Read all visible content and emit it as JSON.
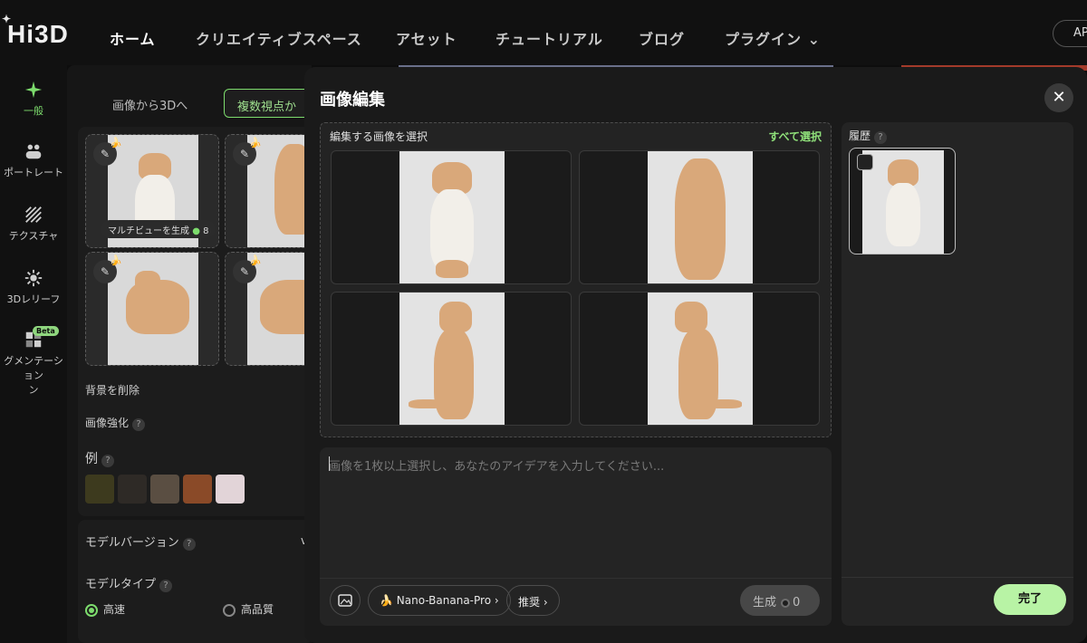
{
  "app": {
    "logo": "Hi3D"
  },
  "nav": {
    "items": [
      "ホーム",
      "クリエイティブスペース",
      "アセット",
      "チュートリアル",
      "ブログ",
      "プラグイン ⌄"
    ],
    "right_button": "AP"
  },
  "sidebar": {
    "items": [
      {
        "label": "一般",
        "icon": "sparkle-icon"
      },
      {
        "label": "ポートレート",
        "icon": "people-icon"
      },
      {
        "label": "テクスチャ",
        "icon": "texture-icon"
      },
      {
        "label": "3Dレリーフ",
        "icon": "relief-icon"
      },
      {
        "label": "グメンテーション",
        "icon": "segment-icon",
        "line2": "ン",
        "badge": "Beta"
      }
    ]
  },
  "left_panel": {
    "tabs": [
      "画像から3Dへ",
      "複数視点か"
    ],
    "generate_pill": "マルチビューを生成",
    "generate_count": "8",
    "remove_bg": "背景を削除",
    "enhance": "画像強化",
    "examples_label": "例",
    "model_version": "モデルバージョン",
    "model_version_value": "v",
    "model_type": "モデルタイプ",
    "type_fast": "高速",
    "type_hq": "高品質"
  },
  "modal": {
    "title": "画像編集",
    "close": "✕",
    "select_title": "編集する画像を選択",
    "select_all": "すべて選択",
    "prompt_placeholder": "画像を1枚以上選択し、あなたのアイデアを入力してください...",
    "model_pill": "Nano-Banana-Pro",
    "recommend_pill": "推奨",
    "generate_label": "生成",
    "generate_cost": "0",
    "history_title": "履歴",
    "done_label": "完了"
  },
  "colors": {
    "accent": "#7ddc6d",
    "done": "#b8f3a5",
    "cat_orange": "#d9a87a",
    "cat_white": "#f2efe9"
  }
}
